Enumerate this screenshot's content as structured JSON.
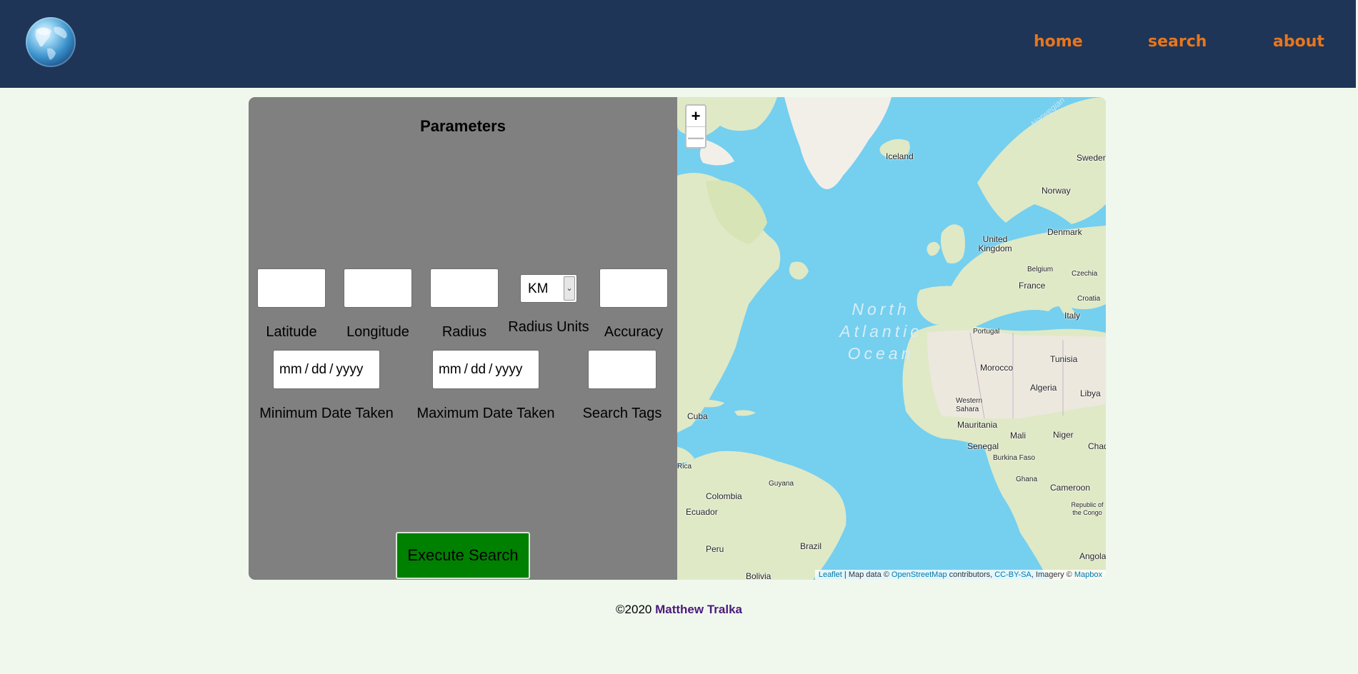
{
  "header": {
    "nav": [
      {
        "label": "home"
      },
      {
        "label": "search"
      },
      {
        "label": "about"
      }
    ]
  },
  "params": {
    "title": "Parameters",
    "fields": [
      {
        "label": "Latitude",
        "value": ""
      },
      {
        "label": "Longitude",
        "value": ""
      },
      {
        "label": "Radius",
        "value": ""
      },
      {
        "label": "Radius Units",
        "value": "KM"
      },
      {
        "label": "Accuracy",
        "value": ""
      }
    ],
    "dates": [
      {
        "label": "Minimum Date Taken",
        "mm": "mm",
        "dd": "dd",
        "yyyy": "yyyy"
      },
      {
        "label": "Maximum Date Taken",
        "mm": "mm",
        "dd": "dd",
        "yyyy": "yyyy"
      }
    ],
    "tags": {
      "label": "Search Tags",
      "value": ""
    },
    "execute_label": "Execute Search"
  },
  "map": {
    "zoom_in": "+",
    "zoom_out": "—",
    "ocean": [
      "North",
      "Atlantic",
      "Ocean"
    ],
    "places": [
      "Norwegian",
      "Iceland",
      "Sweden",
      "Norway",
      "Denmark",
      "United Kingdom",
      "Belgium",
      "Czechia",
      "France",
      "Croatia",
      "Italy",
      "Portugal",
      "Tunisia",
      "Morocco",
      "Algeria",
      "Libya",
      "Western Sahara",
      "Mauritania",
      "Mali",
      "Niger",
      "Senegal",
      "Chad",
      "Burkina Faso",
      "Ghana",
      "Cameroon",
      "Republic of the Congo",
      "Angola",
      "Cuba",
      "Rica",
      "Guyana",
      "Colombia",
      "Ecuador",
      "Peru",
      "Brazil",
      "Bolivia"
    ],
    "attribution": {
      "leaflet": "Leaflet",
      "sep1": " | Map data © ",
      "osm": "OpenStreetMap",
      "sep2": " contributors, ",
      "license": "CC-BY-SA",
      "sep3": ", Imagery © ",
      "mapbox": "Mapbox"
    }
  },
  "footer": {
    "copy": "©2020",
    "author": "Matthew Tralka"
  }
}
